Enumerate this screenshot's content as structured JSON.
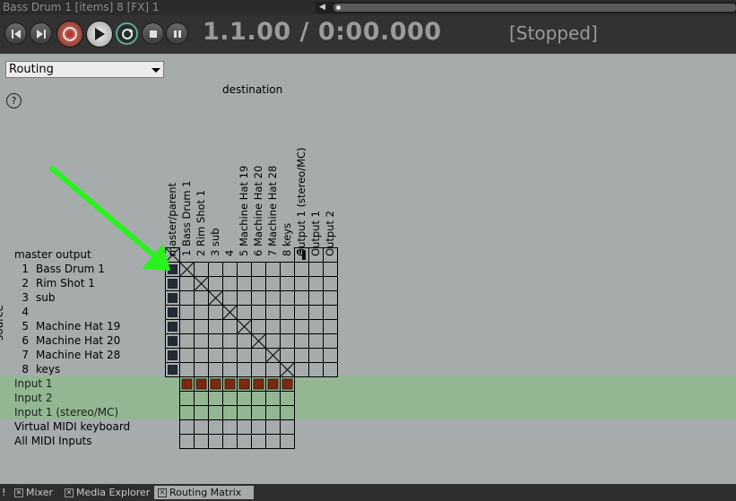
{
  "window": {
    "title": "Bass Drum 1 [items] 8 [FX] 1"
  },
  "transport": {
    "timecode": "1.1.00 / 0:00.000",
    "status": "[Stopped]",
    "buttons": [
      "go-to-start",
      "go-to-end",
      "record",
      "play",
      "repeat",
      "stop",
      "pause"
    ]
  },
  "view_select": {
    "value": "Routing"
  },
  "help": {
    "label": "?"
  },
  "matrix": {
    "destination_label": "destination",
    "source_label": "source",
    "columns": [
      "master/parent",
      "1  Bass Drum 1",
      "2  Rim Shot 1",
      "3  sub",
      "4",
      "5  Machine Hat 19",
      "6  Machine Hat 20",
      "7  Machine Hat 28",
      "8  keys",
      "Output 1 (stereo/MC)",
      "Output 1",
      "Output 2"
    ],
    "rows": [
      {
        "num": "",
        "name": "master output",
        "type": "master"
      },
      {
        "num": "1",
        "name": "Bass Drum 1",
        "type": "track"
      },
      {
        "num": "2",
        "name": "Rim Shot 1",
        "type": "track"
      },
      {
        "num": "3",
        "name": "sub",
        "type": "track"
      },
      {
        "num": "4",
        "name": "",
        "type": "track"
      },
      {
        "num": "5",
        "name": "Machine Hat 19",
        "type": "track"
      },
      {
        "num": "6",
        "name": "Machine Hat 20",
        "type": "track"
      },
      {
        "num": "7",
        "name": "Machine Hat 28",
        "type": "track"
      },
      {
        "num": "8",
        "name": "keys",
        "type": "track"
      },
      {
        "num": "",
        "name": "Input 1",
        "type": "input"
      },
      {
        "num": "",
        "name": "Input 2",
        "type": "input"
      },
      {
        "num": "",
        "name": "Input 1 (stereo/MC)",
        "type": "input"
      },
      {
        "num": "",
        "name": "Virtual MIDI keyboard",
        "type": "midi"
      },
      {
        "num": "",
        "name": "All MIDI Inputs",
        "type": "midi"
      }
    ]
  },
  "colors": {
    "background": "#a5acab",
    "input_highlight": "#92b792",
    "active_send": "#222a32",
    "record_input": "#7b2a10",
    "arrow": "#2af21f"
  },
  "bottom_tabs": [
    {
      "label": "Mixer",
      "active": false
    },
    {
      "label": "Media Explorer",
      "active": false
    },
    {
      "label": "Routing Matrix",
      "active": true
    }
  ]
}
